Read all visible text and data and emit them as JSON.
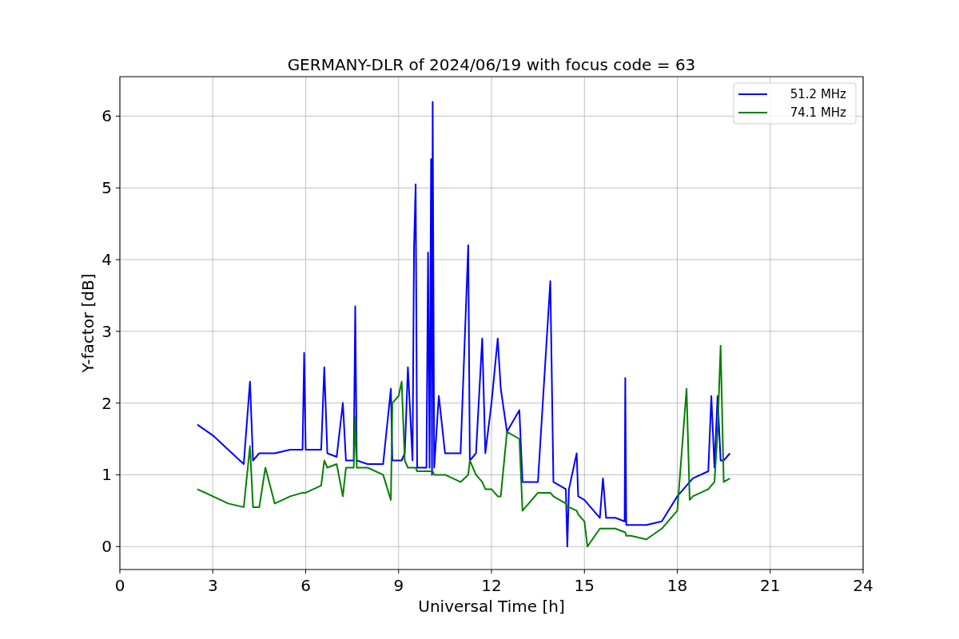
{
  "chart_data": {
    "type": "line",
    "title": "GERMANY-DLR of 2024/06/19 with focus code = 63",
    "xlabel": "Universal Time [h]",
    "ylabel": "Y-factor [dB]",
    "x": [
      2.5,
      3,
      3.5,
      4,
      4.2,
      4.3,
      4.5,
      4.7,
      5,
      5.5,
      5.9,
      5.95,
      6,
      6.5,
      6.6,
      6.7,
      7,
      7.2,
      7.3,
      7.5,
      7.55,
      7.6,
      7.65,
      8,
      8.5,
      8.75,
      8.8,
      9,
      9.1,
      9.2,
      9.3,
      9.45,
      9.5,
      9.55,
      9.6,
      9.9,
      9.95,
      10,
      10.05,
      10.08,
      10.1,
      10.15,
      10.3,
      10.5,
      11,
      11.25,
      11.3,
      11.5,
      11.7,
      11.8,
      12,
      12.2,
      12.3,
      12.5,
      12.9,
      13,
      13.5,
      13.9,
      14,
      14.4,
      14.45,
      14.5,
      14.75,
      14.8,
      15,
      15.1,
      15.5,
      15.6,
      15.7,
      16,
      16.3,
      16.32,
      16.35,
      16.5,
      17,
      17.5,
      18,
      18.3,
      18.4,
      18.5,
      19,
      19.1,
      19.2,
      19.3,
      19.4,
      19.5,
      19.7
    ],
    "series": [
      {
        "name": "51.2 MHz",
        "color": "#0000ff",
        "values": [
          1.7,
          1.55,
          1.35,
          1.15,
          2.3,
          1.2,
          1.3,
          1.3,
          1.3,
          1.35,
          1.35,
          2.7,
          1.35,
          1.35,
          2.5,
          1.3,
          1.25,
          2.0,
          1.2,
          1.2,
          1.2,
          3.35,
          1.2,
          1.15,
          1.15,
          2.2,
          1.2,
          1.2,
          1.2,
          1.3,
          2.5,
          1.2,
          4.2,
          5.05,
          1.1,
          1.1,
          4.1,
          1.1,
          5.4,
          1.0,
          6.2,
          1.1,
          2.1,
          1.3,
          1.3,
          4.2,
          1.2,
          1.3,
          2.9,
          1.3,
          2.0,
          2.9,
          2.2,
          1.6,
          1.9,
          0.9,
          0.9,
          3.7,
          0.9,
          0.8,
          0,
          0.8,
          1.3,
          0.7,
          0.65,
          0.6,
          0.4,
          0.95,
          0.4,
          0.4,
          0.35,
          2.35,
          0.3,
          0.3,
          0.3,
          0.35,
          0.7,
          0.85,
          0.9,
          0.95,
          1.05,
          2.1,
          1.1,
          2.1,
          1.2,
          1.2,
          1.3
        ]
      },
      {
        "name": "74.1 MHz",
        "color": "#008000",
        "values": [
          0.8,
          0.7,
          0.6,
          0.55,
          1.4,
          0.55,
          0.55,
          1.1,
          0.6,
          0.7,
          0.75,
          0.75,
          0.75,
          0.85,
          1.2,
          1.1,
          1.15,
          0.7,
          1.1,
          1.1,
          1.1,
          1.8,
          1.1,
          1.1,
          1.0,
          0.65,
          2.0,
          2.1,
          2.3,
          1.2,
          1.1,
          1.1,
          1.1,
          1.1,
          1.05,
          1.05,
          1.05,
          1.05,
          1.05,
          1.05,
          1.05,
          1.0,
          1.0,
          1.0,
          0.9,
          1.0,
          1.2,
          1.0,
          0.9,
          0.8,
          0.8,
          0.7,
          0.7,
          1.6,
          1.5,
          0.5,
          0.75,
          0.75,
          0.7,
          0.6,
          0.55,
          0.55,
          0.5,
          0.45,
          0.35,
          0.0,
          0.25,
          0.25,
          0.25,
          0.25,
          0.2,
          0.2,
          0.15,
          0.15,
          0.1,
          0.25,
          0.5,
          2.2,
          0.65,
          0.7,
          0.8,
          0.85,
          0.9,
          1.6,
          2.8,
          0.9,
          0.95
        ]
      }
    ],
    "xlim": [
      0,
      24
    ],
    "ylim": [
      -0.32,
      6.55
    ],
    "xticks": [
      0,
      3,
      6,
      9,
      12,
      15,
      18,
      21,
      24
    ],
    "yticks": [
      0,
      1,
      2,
      3,
      4,
      5,
      6
    ],
    "grid": true,
    "legend": true
  }
}
